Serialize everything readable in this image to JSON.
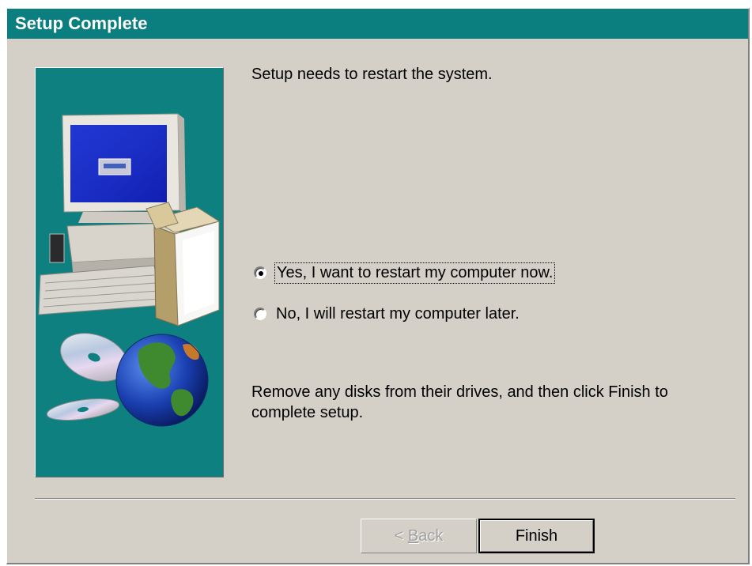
{
  "window": {
    "title": "Setup Complete"
  },
  "content": {
    "restart_message": "Setup needs to restart the system.",
    "options": [
      {
        "label": "Yes, I want to restart my computer now.",
        "checked": true
      },
      {
        "label": "No, I will restart my computer later.",
        "checked": false
      }
    ],
    "instructions": "Remove any disks from their drives, and then click Finish to complete setup."
  },
  "buttons": {
    "back_prefix": "< ",
    "back_mnemonic": "B",
    "back_rest": "ack",
    "back_enabled": false,
    "finish_label": "Finish"
  },
  "illustration": {
    "icons": [
      "computer-monitor-icon",
      "software-box-icon",
      "cd-disc-icon",
      "globe-icon"
    ]
  },
  "colors": {
    "title_bar": "#0b7f80",
    "dialog_face": "#d4d0c8",
    "side_panel": "#0e8080"
  }
}
